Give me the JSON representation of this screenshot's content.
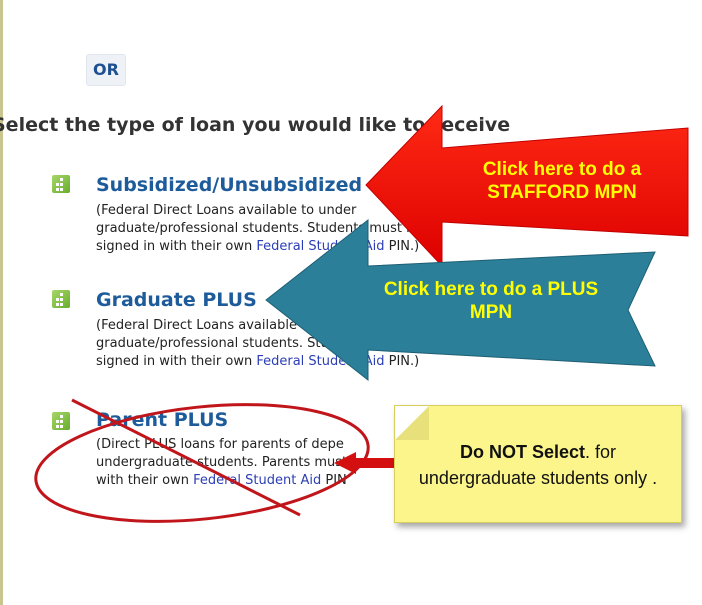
{
  "or_label": "OR",
  "heading": "Select the type of loan you would like to receive",
  "loans": [
    {
      "title": "Subsidized/Unsubsidized",
      "desc_line1": "(Federal Direct Loans available to under",
      "desc_line2": "graduate/professional students. Students must be",
      "desc_line3_pre": "signed in with their own ",
      "desc_link": "Federal Student Aid",
      "desc_line3_post": " PIN.)"
    },
    {
      "title": "Graduate PLUS",
      "desc_line1": "(Federal Direct Loans available to",
      "desc_line2": "graduate/professional students. Students",
      "desc_line3_pre": "signed in with their own ",
      "desc_link": "Federal Student Aid",
      "desc_line3_post": " PIN.)"
    },
    {
      "title": "Parent PLUS",
      "desc_line1": "(Direct PLUS loans for parents of depe",
      "desc_line2": "undergraduate students. Parents must",
      "desc_line3_pre": "with their own ",
      "desc_link": "Federal Student Aid",
      "desc_line3_post": " PIN"
    }
  ],
  "callout_stafford": {
    "line1": "Click here to do a",
    "line2": "STAFFORD MPN"
  },
  "callout_plus": {
    "line1": "Click here to do a PLUS",
    "line2": "MPN"
  },
  "note": {
    "bold": "Do NOT Select",
    "rest": ". for",
    "line2": "undergraduate students only ."
  },
  "colors": {
    "red_arrow": "#ee0a0a",
    "teal_arrow": "#2a7c96",
    "callout_text": "#ffff00",
    "note_bg": "#fbf58c",
    "title_blue": "#1d5b9a"
  }
}
